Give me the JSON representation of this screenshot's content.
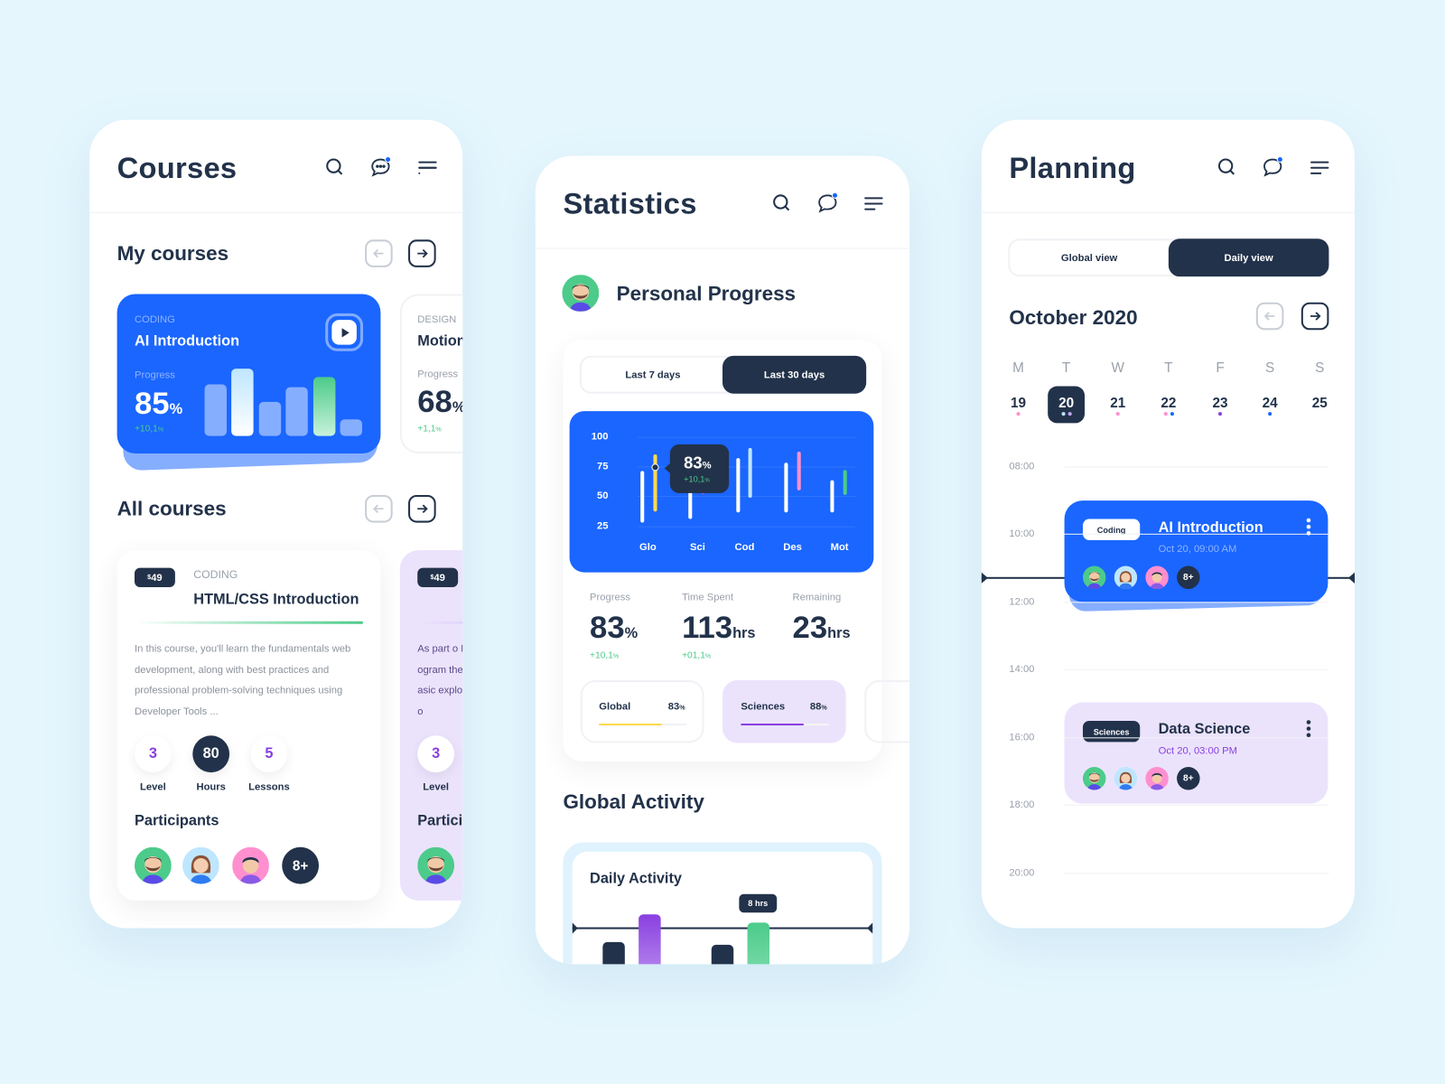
{
  "colors": {
    "dark": "#22324a",
    "blue": "#1a66ff",
    "green": "#4ccb8a",
    "purple": "#8a3fe0",
    "lavender": "#ebe3fc",
    "yellow": "#ffd84d",
    "pink": "#ff8fcf",
    "sky": "#bfe6ff"
  },
  "header_icons": [
    "search-icon",
    "chat-icon",
    "menu-icon"
  ],
  "courses": {
    "title": "Courses",
    "my_courses": {
      "heading": "My courses",
      "cards": [
        {
          "category": "CODING",
          "title": "AI Introduction",
          "progress_label": "Progress",
          "progress": "85",
          "unit": "%",
          "delta": "+10,1",
          "delta_unit": "%",
          "bar_levels": [
            56,
            73,
            37,
            53,
            64,
            18
          ]
        },
        {
          "category": "DESIGN",
          "title": "Motion",
          "progress_label": "Progress",
          "progress": "68",
          "unit": "%",
          "delta": "+1,1",
          "delta_unit": "%"
        }
      ]
    },
    "all_courses": {
      "heading": "All courses",
      "cards": [
        {
          "price_symbol": "$",
          "price": "49",
          "category": "CODING",
          "title": "HTML/CSS Introduction",
          "description": "In this course, you'll learn the fundamentals web development, along with best practices and professional problem-solving techniques using Developer Tools ...",
          "level": "3",
          "level_label": "Level",
          "hours": "80",
          "hours_label": "Hours",
          "lessons": "5",
          "lessons_label": "Lessons",
          "participants_label": "Participants",
          "more": "8+"
        },
        {
          "price_symbol": "$",
          "price": "49",
          "description": "As part o Program the basic explorato",
          "level": "3",
          "level_label": "Level",
          "participants_label": "Partici"
        }
      ]
    }
  },
  "statistics": {
    "title": "Statistics",
    "section_title": "Personal Progress",
    "tabs": [
      {
        "label": "Last 7 days",
        "active": false
      },
      {
        "label": "Last 30 days",
        "active": true
      }
    ],
    "tooltip": {
      "value": "83",
      "unit": "%",
      "delta": "+10,1",
      "delta_unit": "%"
    },
    "stats": [
      {
        "label": "Progress",
        "value": "83",
        "unit": "%",
        "delta": "+10,1",
        "delta_unit": "%"
      },
      {
        "label": "Time Spent",
        "value": "113",
        "unit": "hrs",
        "delta": "+01,1",
        "delta_unit": "%"
      },
      {
        "label": "Remaining",
        "value": "23",
        "unit": "hrs"
      }
    ],
    "subjects": [
      {
        "label": "Global",
        "value": "83",
        "unit": "%",
        "fill": 0.72,
        "color": "#ffd84d"
      },
      {
        "label": "Sciences",
        "value": "88",
        "unit": "%",
        "fill": 0.72,
        "color": "#8a3fe0"
      }
    ],
    "global_activity_title": "Global Activity",
    "daily_activity": {
      "title": "Daily Activity",
      "tooltip": "8 hrs"
    }
  },
  "chart_data": {
    "type": "range-bar",
    "categories": [
      "Glo",
      "Sci",
      "Cod",
      "Des",
      "Mot"
    ],
    "ylim": [
      25,
      100
    ],
    "yticks": [
      100,
      75,
      50,
      25
    ],
    "grid": true,
    "series": [
      {
        "color": "#ffffff",
        "ranges": [
          [
            28,
            71
          ],
          [
            31,
            72
          ],
          [
            36,
            82
          ],
          [
            36,
            78
          ],
          [
            36,
            63
          ]
        ]
      },
      {
        "color_by_category": [
          "#ffd84d",
          "#c54bd8",
          "#bfe6ff",
          "#ff8fcf",
          "#4ccb8a"
        ],
        "ranges": [
          [
            37,
            85
          ],
          [
            52,
            80
          ],
          [
            49,
            90
          ],
          [
            55,
            87
          ],
          [
            51,
            72
          ]
        ]
      }
    ],
    "highlight": {
      "category": "Glo",
      "value": 74
    }
  },
  "planning": {
    "title": "Planning",
    "toggle": [
      {
        "label": "Global view",
        "active": false
      },
      {
        "label": "Daily view",
        "active": true
      }
    ],
    "month": "October 2020",
    "weekdays": [
      "M",
      "T",
      "W",
      "T",
      "F",
      "S",
      "S"
    ],
    "dates": [
      "19",
      "20",
      "21",
      "22",
      "23",
      "24",
      "25"
    ],
    "selected_date": "20",
    "times": [
      "08:00",
      "10:00",
      "12:00",
      "14:00",
      "16:00",
      "18:00",
      "20:00"
    ],
    "events": [
      {
        "tag": "Coding",
        "title": "AI Introduction",
        "datetime": "Oct 20, 09:00 AM",
        "more": "8+"
      },
      {
        "tag": "Sciences",
        "title": "Data Science",
        "datetime": "Oct 20, 03:00 PM",
        "more": "8+"
      }
    ]
  }
}
